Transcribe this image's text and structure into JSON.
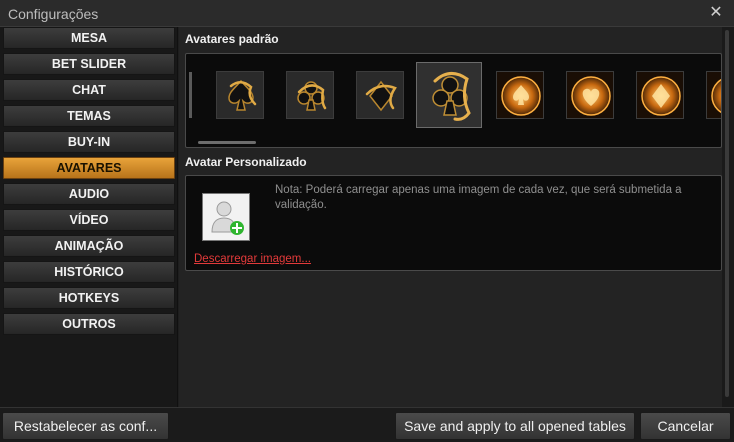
{
  "window": {
    "title": "Configurações",
    "close_icon": "close-icon"
  },
  "sidebar": {
    "items": [
      {
        "label": "MESA",
        "active": false
      },
      {
        "label": "BET SLIDER",
        "active": false
      },
      {
        "label": "CHAT",
        "active": false
      },
      {
        "label": "TEMAS",
        "active": false
      },
      {
        "label": "BUY-IN",
        "active": false
      },
      {
        "label": "AVATARES",
        "active": true
      },
      {
        "label": "AUDIO",
        "active": false
      },
      {
        "label": "VÍDEO",
        "active": false
      },
      {
        "label": "ANIMAÇÃO",
        "active": false
      },
      {
        "label": "HISTÓRICO",
        "active": false
      },
      {
        "label": "HOTKEYS",
        "active": false
      },
      {
        "label": "OUTROS",
        "active": false
      }
    ]
  },
  "default_avatars": {
    "label": "Avatares padrão",
    "items": [
      {
        "icon": "gold-spade-dragon-icon",
        "selected": false
      },
      {
        "icon": "gold-club-dragon-icon",
        "selected": false
      },
      {
        "icon": "gold-diamond-dragon-icon",
        "selected": false
      },
      {
        "icon": "gold-club-dragon-large-icon",
        "selected": true
      },
      {
        "icon": "glowing-spade-coin-icon",
        "selected": false
      },
      {
        "icon": "glowing-heart-coin-icon",
        "selected": false
      },
      {
        "icon": "glowing-diamond-coin-icon",
        "selected": false
      },
      {
        "icon": "glowing-coin-partial-icon",
        "selected": false
      }
    ]
  },
  "custom_avatar": {
    "label": "Avatar Personalizado",
    "note": "Nota: Poderá carregar apenas uma imagem de cada vez, que será submetida a validação.",
    "download_link": "Descarregar imagem...",
    "avatar_icon": "user-add-icon"
  },
  "footer": {
    "reset_label": "Restabelecer as conf...",
    "save_label": "Save and apply to all opened tables",
    "cancel_label": "Cancelar"
  },
  "colors": {
    "accent": "#d89030",
    "link": "#e23a3a",
    "background": "#1e1e1e"
  }
}
